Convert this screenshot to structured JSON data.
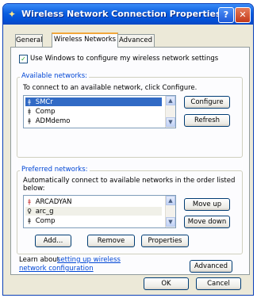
{
  "window": {
    "title": "Wireless Network Connection Properties",
    "help_label": "?",
    "close_label": "✕"
  },
  "tabs": [
    {
      "label": "General"
    },
    {
      "label": "Wireless Networks"
    },
    {
      "label": "Advanced"
    }
  ],
  "use_windows": {
    "checked": true,
    "label": "Use Windows to configure my wireless network settings"
  },
  "available": {
    "title": "Available networks:",
    "description": "To connect to an available network, click Configure.",
    "items": [
      {
        "name": "SMCr",
        "icon": "antenna-icon",
        "selected": true
      },
      {
        "name": "Comp",
        "icon": "antenna-icon",
        "selected": false
      },
      {
        "name": "ADMdemo",
        "icon": "antenna-icon",
        "selected": false
      }
    ],
    "configure_label": "Configure",
    "refresh_label": "Refresh"
  },
  "preferred": {
    "title": "Preferred networks:",
    "description": "Automatically connect to available networks in the order listed below:",
    "items": [
      {
        "name": "ARCADYAN",
        "icon": "antenna-error-icon"
      },
      {
        "name": "arc_g",
        "icon": "antenna-icon"
      },
      {
        "name": "Comp",
        "icon": "antenna-icon"
      }
    ],
    "move_up_label": "Move up",
    "move_down_label": "Move down",
    "add_label": "Add...",
    "remove_label": "Remove",
    "properties_label": "Properties"
  },
  "learn": {
    "prefix": "Learn about",
    "link": "setting up wireless network configuration",
    "advanced_label": "Advanced"
  },
  "footer": {
    "ok_label": "OK",
    "cancel_label": "Cancel"
  }
}
